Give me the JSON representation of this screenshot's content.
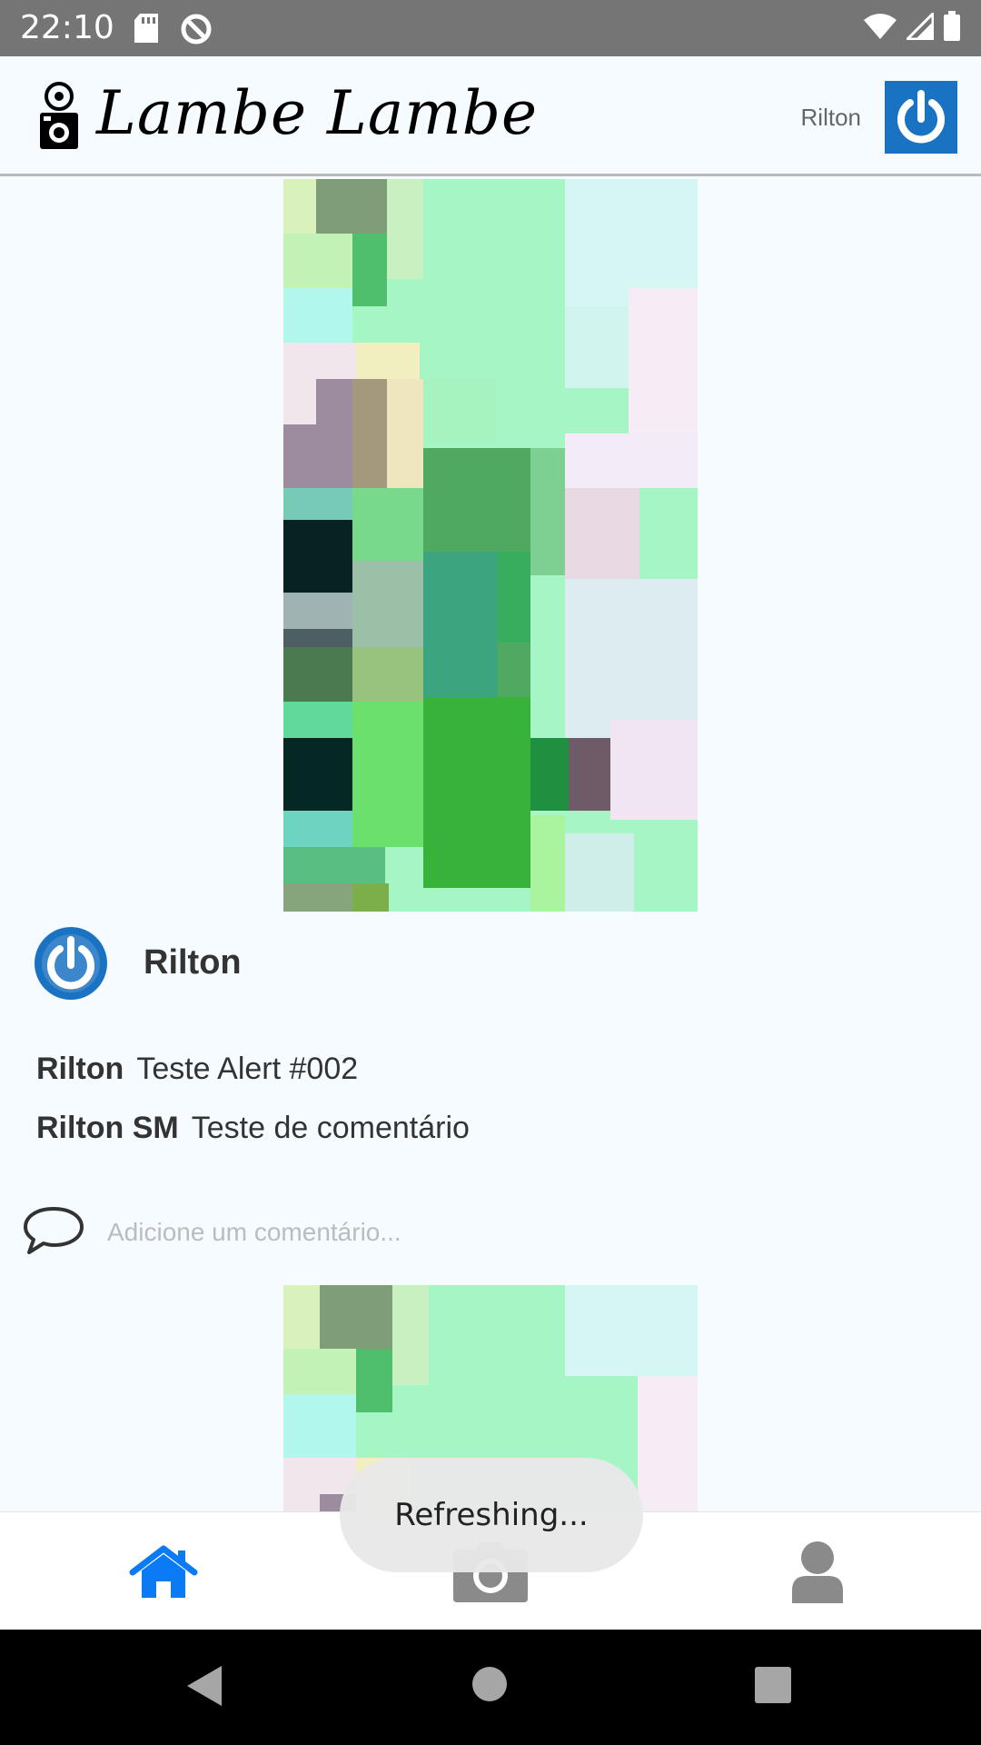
{
  "status_bar": {
    "time": "22:10",
    "icons": [
      "sd-card-icon",
      "no-sync-icon",
      "wifi-icon",
      "signal-icon",
      "battery-icon"
    ]
  },
  "header": {
    "app_title": "Lambe Lambe",
    "user_name": "Rilton",
    "logo_icon": "camera-logo-icon",
    "avatar_icon": "power-icon"
  },
  "post": {
    "author": "Rilton",
    "comments": [
      {
        "user": "Rilton",
        "text": "Teste Alert #002"
      },
      {
        "user": "Rilton SM",
        "text": "Teste de comentário"
      }
    ],
    "add_comment_placeholder": "Adicione um comentário..."
  },
  "bottom_nav": {
    "items": [
      {
        "icon": "home-icon",
        "active": true
      },
      {
        "icon": "camera-icon",
        "active": false
      },
      {
        "icon": "user-icon",
        "active": false
      }
    ]
  },
  "toast": {
    "text": "Refreshing..."
  },
  "colors": {
    "accent": "#0a7bf5",
    "avatar_blue": "#1a73c2",
    "inactive_icon": "#8a8a8a",
    "status_bar": "#757575",
    "background": "#f5fbff"
  }
}
